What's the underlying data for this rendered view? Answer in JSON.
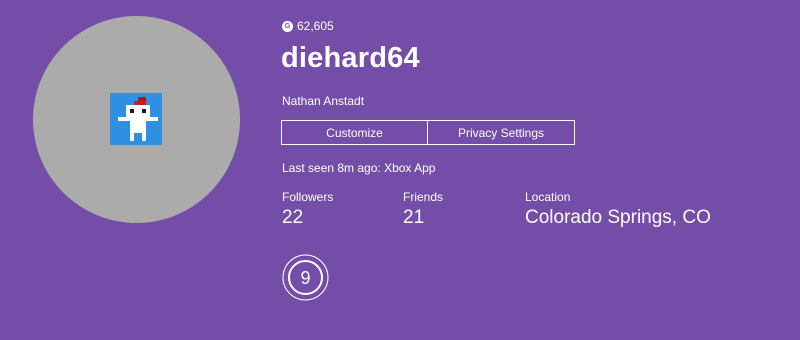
{
  "profile": {
    "gamerscore": "62,605",
    "gamerscore_icon": "gamerscore-icon",
    "gamertag": "diehard64",
    "real_name": "Nathan Anstadt",
    "last_seen": "Last seen 8m ago: Xbox App",
    "avatar_icon": "pixel-character-avatar",
    "reputation_level": "9"
  },
  "actions": {
    "customize_label": "Customize",
    "privacy_label": "Privacy Settings"
  },
  "stats": {
    "followers_label": "Followers",
    "followers_value": "22",
    "friends_label": "Friends",
    "friends_value": "21",
    "location_label": "Location",
    "location_value": "Colorado Springs, CO"
  },
  "colors": {
    "background": "#744da9",
    "avatar_circle": "#ababab",
    "avatar_bg": "#2f8fe0",
    "text": "#ffffff"
  }
}
